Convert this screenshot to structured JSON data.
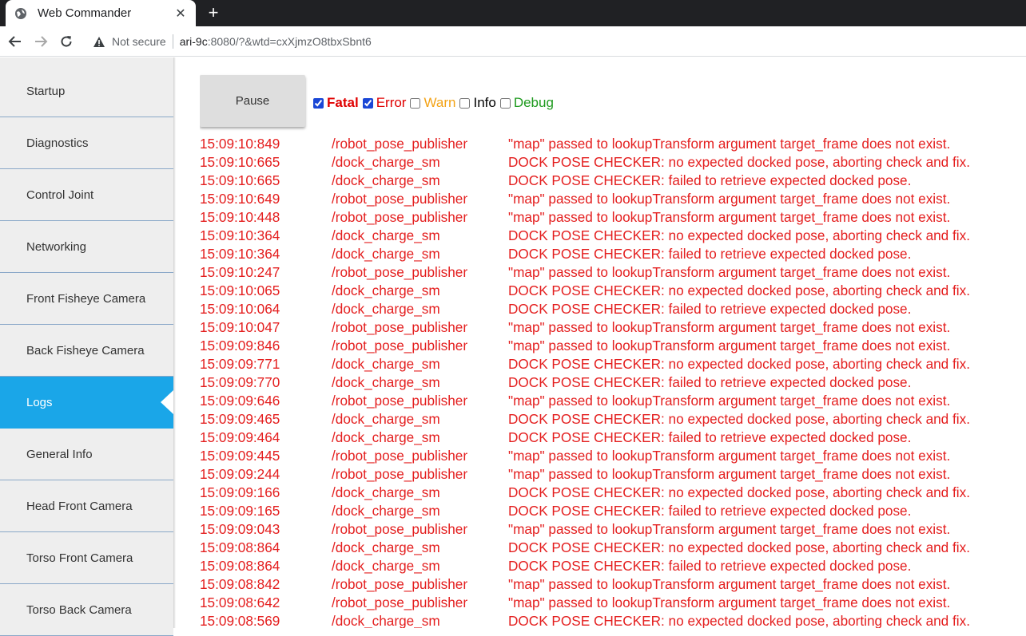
{
  "browser": {
    "tab_title": "Web Commander",
    "security_label": "Not secure",
    "url_host": "ari-9c",
    "url_rest": ":8080/?&wtd=cxXjmzO8tbxSbnt6"
  },
  "sidebar": {
    "items": [
      {
        "label": "Startup",
        "active": false
      },
      {
        "label": "Diagnostics",
        "active": false
      },
      {
        "label": "Control Joint",
        "active": false
      },
      {
        "label": "Networking",
        "active": false
      },
      {
        "label": "Front Fisheye Camera",
        "active": false
      },
      {
        "label": "Back Fisheye Camera",
        "active": false
      },
      {
        "label": "Logs",
        "active": true
      },
      {
        "label": "General Info",
        "active": false
      },
      {
        "label": "Head Front Camera",
        "active": false
      },
      {
        "label": "Torso Front Camera",
        "active": false
      },
      {
        "label": "Torso Back Camera",
        "active": false
      }
    ],
    "active_color": "#1aa6e8"
  },
  "controls": {
    "pause_label": "Pause",
    "filters": [
      {
        "label": "Fatal",
        "checked": true,
        "color": "#e00000"
      },
      {
        "label": "Error",
        "checked": true,
        "color": "#e00000"
      },
      {
        "label": "Warn",
        "checked": false,
        "color": "#f3a317"
      },
      {
        "label": "Info",
        "checked": false,
        "color": "#000000"
      },
      {
        "label": "Debug",
        "checked": false,
        "color": "#1e9a1e"
      }
    ]
  },
  "log": {
    "color": "#e41e1e",
    "rows": [
      {
        "time": "15:09:10:849",
        "node": "/robot_pose_publisher",
        "msg": "\"map\" passed to lookupTransform argument target_frame does not exist."
      },
      {
        "time": "15:09:10:665",
        "node": "/dock_charge_sm",
        "msg": "DOCK POSE CHECKER: no expected docked pose, aborting check and fix."
      },
      {
        "time": "15:09:10:665",
        "node": "/dock_charge_sm",
        "msg": "DOCK POSE CHECKER: failed to retrieve expected docked pose."
      },
      {
        "time": "15:09:10:649",
        "node": "/robot_pose_publisher",
        "msg": "\"map\" passed to lookupTransform argument target_frame does not exist."
      },
      {
        "time": "15:09:10:448",
        "node": "/robot_pose_publisher",
        "msg": "\"map\" passed to lookupTransform argument target_frame does not exist."
      },
      {
        "time": "15:09:10:364",
        "node": "/dock_charge_sm",
        "msg": "DOCK POSE CHECKER: no expected docked pose, aborting check and fix."
      },
      {
        "time": "15:09:10:364",
        "node": "/dock_charge_sm",
        "msg": "DOCK POSE CHECKER: failed to retrieve expected docked pose."
      },
      {
        "time": "15:09:10:247",
        "node": "/robot_pose_publisher",
        "msg": "\"map\" passed to lookupTransform argument target_frame does not exist."
      },
      {
        "time": "15:09:10:065",
        "node": "/dock_charge_sm",
        "msg": "DOCK POSE CHECKER: no expected docked pose, aborting check and fix."
      },
      {
        "time": "15:09:10:064",
        "node": "/dock_charge_sm",
        "msg": "DOCK POSE CHECKER: failed to retrieve expected docked pose."
      },
      {
        "time": "15:09:10:047",
        "node": "/robot_pose_publisher",
        "msg": "\"map\" passed to lookupTransform argument target_frame does not exist."
      },
      {
        "time": "15:09:09:846",
        "node": "/robot_pose_publisher",
        "msg": "\"map\" passed to lookupTransform argument target_frame does not exist."
      },
      {
        "time": "15:09:09:771",
        "node": "/dock_charge_sm",
        "msg": "DOCK POSE CHECKER: no expected docked pose, aborting check and fix."
      },
      {
        "time": "15:09:09:770",
        "node": "/dock_charge_sm",
        "msg": "DOCK POSE CHECKER: failed to retrieve expected docked pose."
      },
      {
        "time": "15:09:09:646",
        "node": "/robot_pose_publisher",
        "msg": "\"map\" passed to lookupTransform argument target_frame does not exist."
      },
      {
        "time": "15:09:09:465",
        "node": "/dock_charge_sm",
        "msg": "DOCK POSE CHECKER: no expected docked pose, aborting check and fix."
      },
      {
        "time": "15:09:09:464",
        "node": "/dock_charge_sm",
        "msg": "DOCK POSE CHECKER: failed to retrieve expected docked pose."
      },
      {
        "time": "15:09:09:445",
        "node": "/robot_pose_publisher",
        "msg": "\"map\" passed to lookupTransform argument target_frame does not exist."
      },
      {
        "time": "15:09:09:244",
        "node": "/robot_pose_publisher",
        "msg": "\"map\" passed to lookupTransform argument target_frame does not exist."
      },
      {
        "time": "15:09:09:166",
        "node": "/dock_charge_sm",
        "msg": "DOCK POSE CHECKER: no expected docked pose, aborting check and fix."
      },
      {
        "time": "15:09:09:165",
        "node": "/dock_charge_sm",
        "msg": "DOCK POSE CHECKER: failed to retrieve expected docked pose."
      },
      {
        "time": "15:09:09:043",
        "node": "/robot_pose_publisher",
        "msg": "\"map\" passed to lookupTransform argument target_frame does not exist."
      },
      {
        "time": "15:09:08:864",
        "node": "/dock_charge_sm",
        "msg": "DOCK POSE CHECKER: no expected docked pose, aborting check and fix."
      },
      {
        "time": "15:09:08:864",
        "node": "/dock_charge_sm",
        "msg": "DOCK POSE CHECKER: failed to retrieve expected docked pose."
      },
      {
        "time": "15:09:08:842",
        "node": "/robot_pose_publisher",
        "msg": "\"map\" passed to lookupTransform argument target_frame does not exist."
      },
      {
        "time": "15:09:08:642",
        "node": "/robot_pose_publisher",
        "msg": "\"map\" passed to lookupTransform argument target_frame does not exist."
      },
      {
        "time": "15:09:08:569",
        "node": "/dock_charge_sm",
        "msg": "DOCK POSE CHECKER: no expected docked pose, aborting check and fix."
      }
    ]
  }
}
